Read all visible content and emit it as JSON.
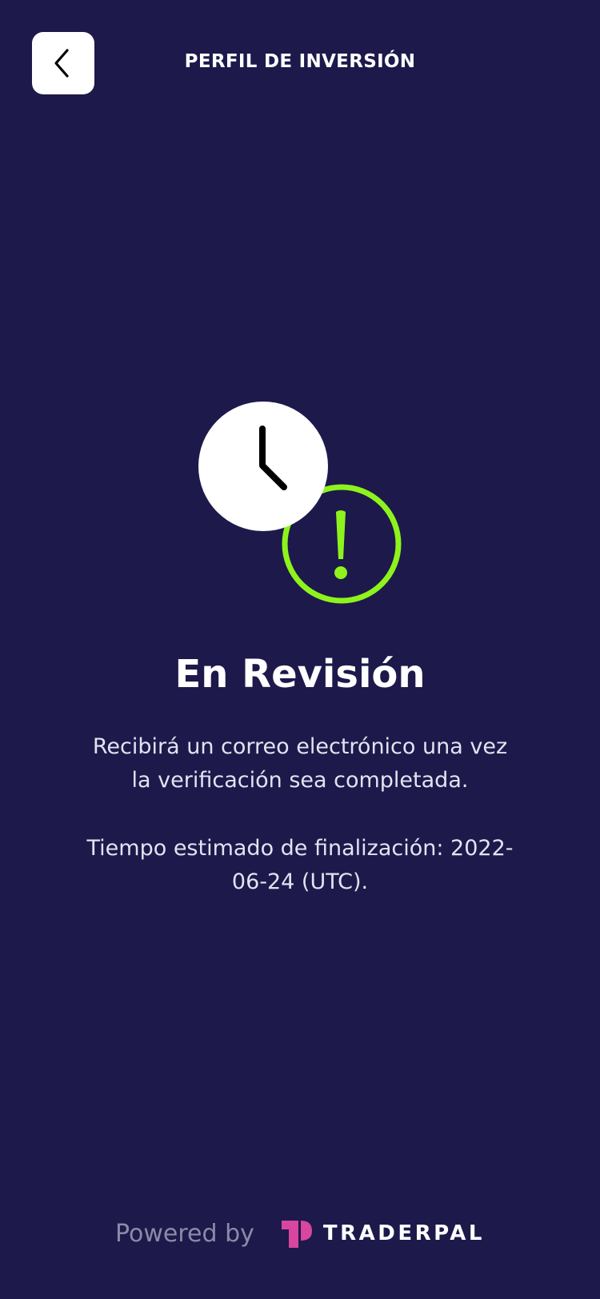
{
  "header": {
    "title": "PERFIL DE INVERSIÓN",
    "back_icon": "chevron-left-icon"
  },
  "status": {
    "title": "En Revisión",
    "message_line1": "Recibirá un correo electrónico una vez la verificación sea completada.",
    "message_line2": "Tiempo estimado de finalización: 2022-06-24 (UTC).",
    "icons": [
      "clock-icon",
      "alert-circle-icon"
    ]
  },
  "footer": {
    "powered_by": "Powered by",
    "brand": "TRADERPAL",
    "brand_logo": "traderpal-logo"
  },
  "colors": {
    "background": "#1d194b",
    "accent_green": "#8ef31c",
    "logo_pink": "#d8469f",
    "muted_text": "#8d8aa8"
  }
}
